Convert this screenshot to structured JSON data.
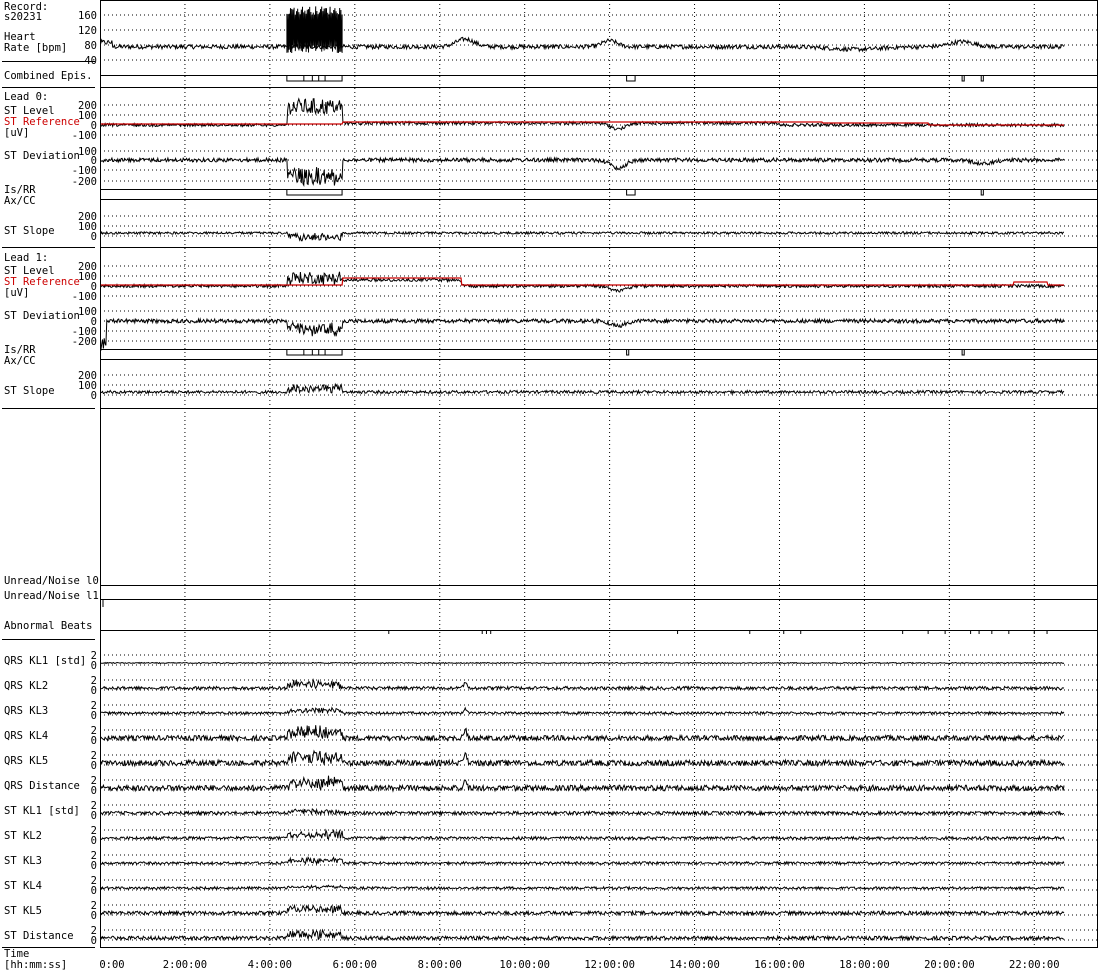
{
  "header": {
    "record_label": "Record:",
    "record_id": "s20231"
  },
  "labels": {
    "heart_rate_1": "Heart",
    "heart_rate_2": "Rate [bpm]",
    "combined_epis": "Combined Epis.",
    "lead0": "Lead 0:",
    "lead1": "Lead 1:",
    "st_level": "ST Level",
    "st_reference": "ST Reference",
    "uv": "[uV]",
    "st_deviation": "ST Deviation",
    "is_rr": "Is/RR",
    "ax_cc": "Ax/CC",
    "st_slope": "ST Slope",
    "unread_noise_l0": "Unread/Noise l0",
    "unread_noise_l1": "Unread/Noise l1",
    "abnormal_beats": "Abnormal Beats",
    "qrs_kl1": "QRS KL1 [std]",
    "qrs_kl2": "QRS KL2",
    "qrs_kl3": "QRS KL3",
    "qrs_kl4": "QRS KL4",
    "qrs_kl5": "QRS KL5",
    "qrs_distance": "QRS Distance",
    "st_kl1": "ST KL1 [std]",
    "st_kl2": "ST KL2",
    "st_kl3": "ST KL3",
    "st_kl4": "ST KL4",
    "st_kl5": "ST KL5",
    "st_distance": "ST Distance",
    "time_1": "Time",
    "time_2": "[hh:mm:ss]"
  },
  "colors": {
    "trace": "#000000",
    "reference": "#cc0000",
    "grid": "#000000",
    "background": "#ffffff"
  },
  "chart_data": {
    "type": "line",
    "xlabel": "Time [hh:mm:ss]",
    "xlim_hours": [
      0,
      23.5
    ],
    "x_ticks": [
      "0:00",
      "2:00:00",
      "4:00:00",
      "6:00:00",
      "8:00:00",
      "10:00:00",
      "12:00:00",
      "14:00:00",
      "16:00:00",
      "18:00:00",
      "20:00:00",
      "22:00:00"
    ],
    "grid": "dotted",
    "panels": {
      "heart_rate": {
        "yticks": [
          "160",
          "120",
          "80",
          "40"
        ],
        "ylim": [
          30,
          175
        ],
        "baseline": 75,
        "noisy_burst_hours": [
          4.4,
          5.7
        ]
      },
      "lead0_st_level": {
        "yticks": [
          "200",
          "100",
          "0",
          "-100"
        ],
        "ylim": [
          -150,
          250
        ],
        "reference_level": 20
      },
      "lead0_st_deviation": {
        "yticks": [
          "100",
          "0",
          "-100",
          "-200"
        ],
        "ylim": [
          -250,
          150
        ]
      },
      "lead0_st_slope": {
        "yticks": [
          "200",
          "100",
          "0"
        ],
        "ylim": [
          -50,
          260
        ]
      },
      "lead1_st_level": {
        "yticks": [
          "200",
          "100",
          "0",
          "-100"
        ],
        "ylim": [
          -150,
          250
        ],
        "reference_level": 40
      },
      "lead1_st_deviation": {
        "yticks": [
          "100",
          "0",
          "-100",
          "-200"
        ],
        "ylim": [
          -250,
          150
        ]
      },
      "lead1_st_slope": {
        "yticks": [
          "200",
          "100",
          "0"
        ],
        "ylim": [
          -50,
          260
        ]
      },
      "kl_panels": {
        "yticks": [
          "2",
          "0"
        ]
      }
    },
    "episodes": {
      "combined": [
        [
          4.4,
          5.7
        ],
        [
          12.4,
          12.6
        ],
        [
          20.3,
          20.35
        ],
        [
          20.75,
          20.8
        ]
      ],
      "lead0_isrr": [
        [
          4.4,
          5.7
        ],
        [
          12.4,
          12.6
        ],
        [
          20.75,
          20.8
        ]
      ],
      "lead1_isrr": [
        [
          4.4,
          5.7
        ],
        [
          12.4,
          12.45
        ],
        [
          20.3,
          20.35
        ]
      ]
    }
  }
}
